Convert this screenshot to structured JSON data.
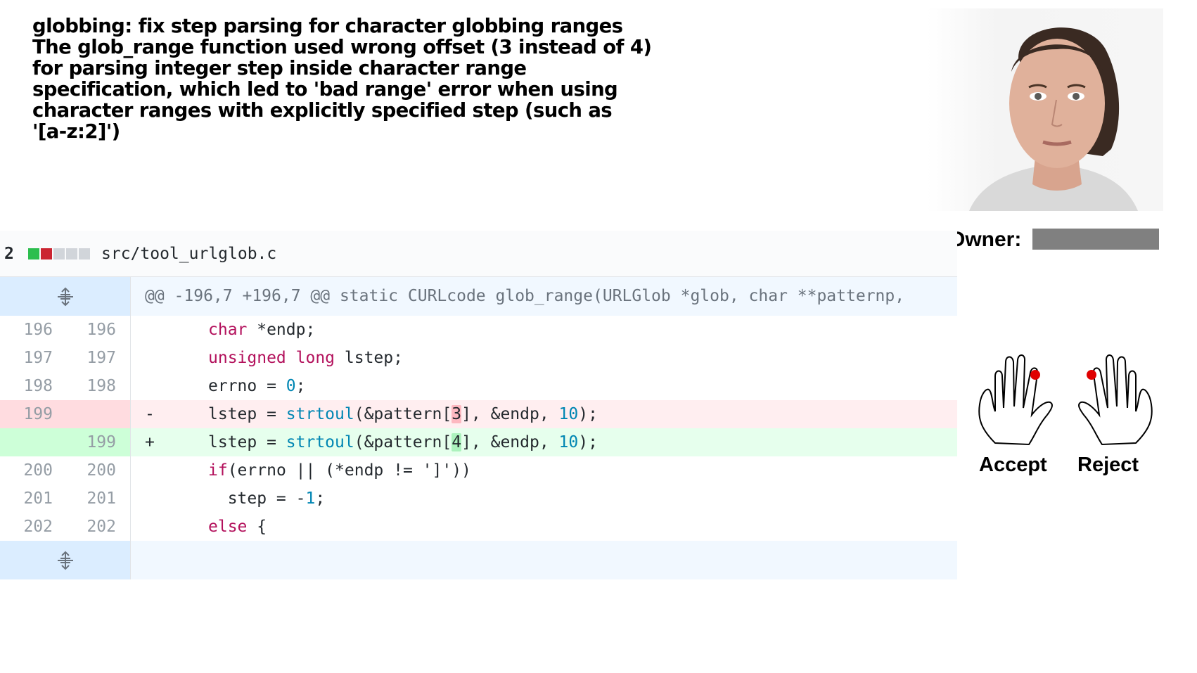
{
  "commit": {
    "lines": [
      "globbing: fix step parsing for character globbing ranges",
      "The glob_range function used wrong offset (3 instead of 4)",
      "for parsing integer step inside character range",
      "specification, which led to 'bad range' error when using",
      "character ranges with explicitly specified step (such as",
      "'[a-z:2]')"
    ]
  },
  "owner": {
    "label": "Owner:"
  },
  "diff": {
    "changes_count": "2",
    "file_path": "src/tool_urlglob.c",
    "hunk_header": "@@ -196,7 +196,7 @@ static CURLcode glob_range(URLGlob *glob, char **patternp,",
    "lines": [
      {
        "old": "196",
        "new": "196",
        "marker": "",
        "type": "ctx"
      },
      {
        "old": "197",
        "new": "197",
        "marker": "",
        "type": "ctx"
      },
      {
        "old": "198",
        "new": "198",
        "marker": "",
        "type": "ctx"
      },
      {
        "old": "199",
        "new": "",
        "marker": "-",
        "type": "del"
      },
      {
        "old": "",
        "new": "199",
        "marker": "+",
        "type": "add"
      },
      {
        "old": "200",
        "new": "200",
        "marker": "",
        "type": "ctx"
      },
      {
        "old": "201",
        "new": "201",
        "marker": "",
        "type": "ctx"
      },
      {
        "old": "202",
        "new": "202",
        "marker": "",
        "type": "ctx"
      }
    ],
    "code": {
      "l0_kw": "char",
      "l0_rest": " *endp;",
      "l1_kw1": "unsigned",
      "l1_kw2": "long",
      "l1_rest": " lstep;",
      "l2_a": "errno = ",
      "l2_num": "0",
      "l2_b": ";",
      "l3_a": "lstep = ",
      "l3_fn": "strtoul",
      "l3_b": "(&pattern[",
      "l3_hl": "3",
      "l3_c": "], &endp, ",
      "l3_num": "10",
      "l3_d": ");",
      "l4_a": "lstep = ",
      "l4_fn": "strtoul",
      "l4_b": "(&pattern[",
      "l4_hl": "4",
      "l4_c": "], &endp, ",
      "l4_num": "10",
      "l4_d": ");",
      "l5_kw": "if",
      "l5_rest": "(errno || (*endp != ']'))",
      "l6_a": "  step = -",
      "l6_num": "1",
      "l6_b": ";",
      "l7_kw": "else",
      "l7_rest": " {"
    },
    "colors": {
      "added": "#2cbe4e",
      "deleted": "#cb2431",
      "neutral": "#d1d5da"
    }
  },
  "vote": {
    "accept_label": "Accept",
    "reject_label": "Reject"
  },
  "icons": {
    "expand": "unfold-icon",
    "accept": "hand-accept-icon",
    "reject": "hand-reject-icon"
  }
}
